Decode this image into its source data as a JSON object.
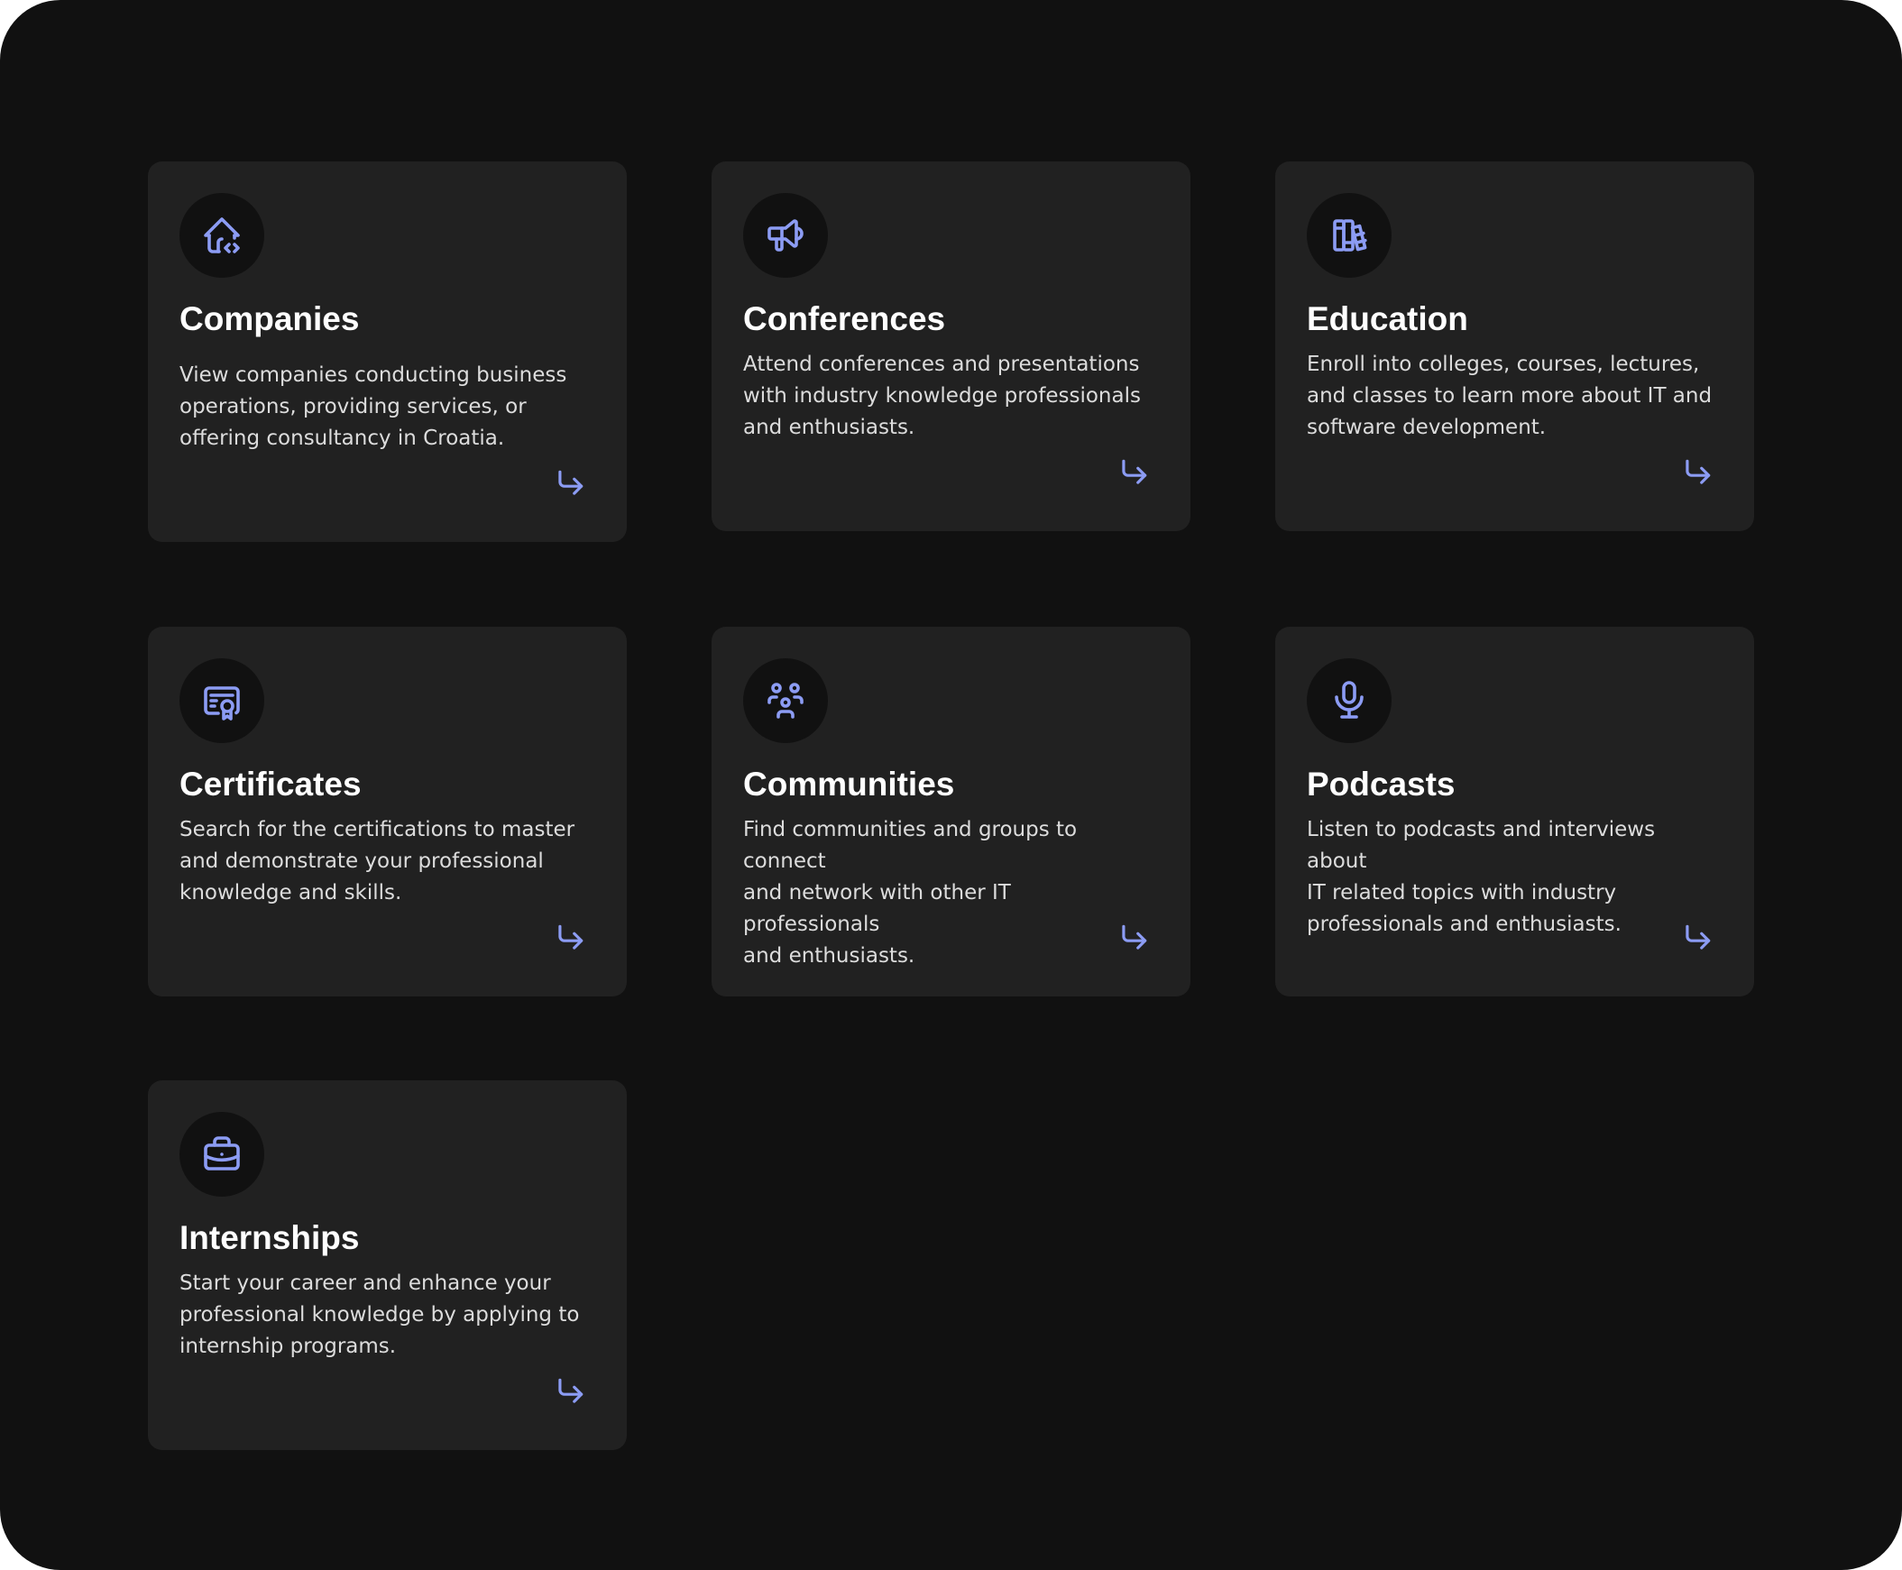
{
  "accent_color": "#8c9cf4",
  "cards": [
    {
      "icon": "house-code-icon",
      "title": "Companies",
      "lines": [
        "View companies conducting business",
        "operations, providing services, or",
        "offering consultancy in Croatia."
      ]
    },
    {
      "icon": "megaphone-icon",
      "title": "Conferences",
      "lines": [
        "Attend conferences and presentations",
        "with industry knowledge professionals",
        "and enthusiasts."
      ]
    },
    {
      "icon": "books-icon",
      "title": "Education",
      "lines": [
        "Enroll into colleges, courses, lectures,",
        "and classes to learn more about IT and",
        "software development."
      ]
    },
    {
      "icon": "certificate-icon",
      "title": "Certificates",
      "lines": [
        "Search for the certifications to master",
        "and demonstrate your professional",
        "knowledge and skills."
      ]
    },
    {
      "icon": "users-group-icon",
      "title": "Communities",
      "lines": [
        "Find communities and groups to connect",
        "and network with other IT professionals",
        "and enthusiasts."
      ]
    },
    {
      "icon": "microphone-icon",
      "title": "Podcasts",
      "lines": [
        "Listen to podcasts and interviews about",
        "IT related topics with industry",
        "professionals and enthusiasts."
      ]
    },
    {
      "icon": "briefcase-icon",
      "title": "Internships",
      "lines": [
        "Start your career and enhance your",
        "professional knowledge by applying to",
        "internship programs."
      ]
    }
  ]
}
